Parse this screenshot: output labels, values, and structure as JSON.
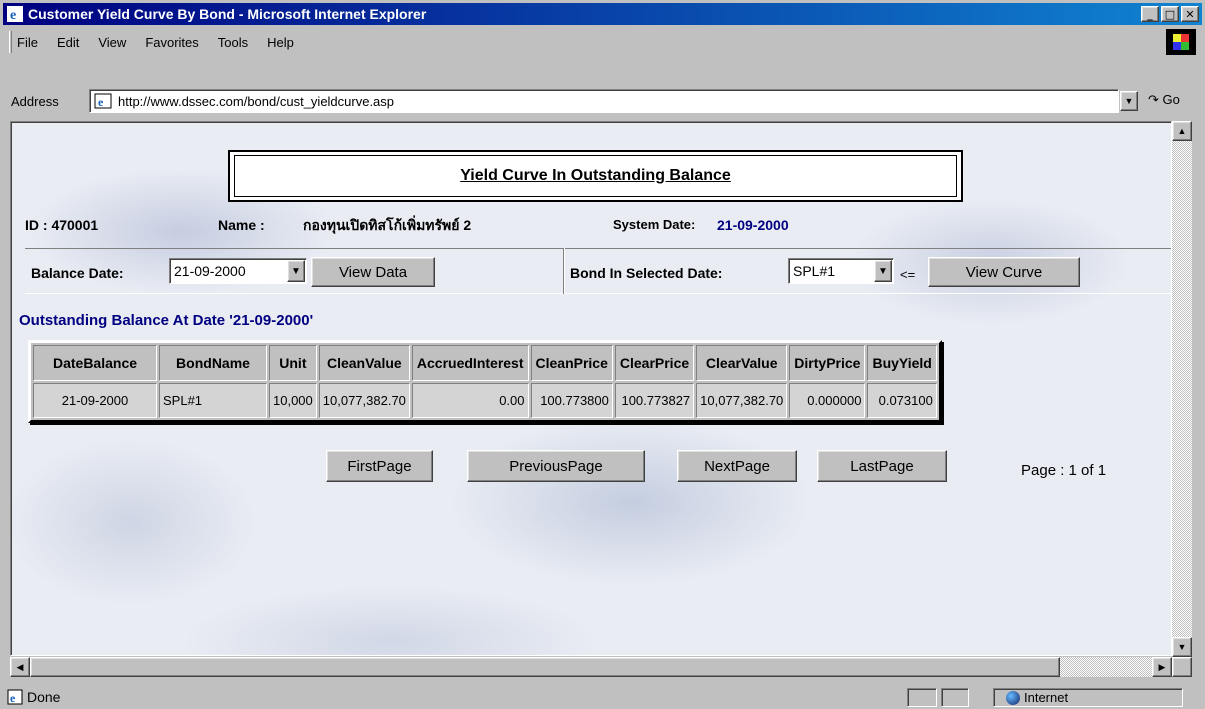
{
  "window": {
    "title": "Customer Yield Curve By Bond - Microsoft Internet Explorer"
  },
  "menu": [
    {
      "label": "File"
    },
    {
      "label": "Edit"
    },
    {
      "label": "View"
    },
    {
      "label": "Favorites"
    },
    {
      "label": "Tools"
    },
    {
      "label": "Help"
    }
  ],
  "address": {
    "label": "Address",
    "url": "http://www.dssec.com/bond/cust_yieldcurve.asp",
    "go_label": "Go"
  },
  "page": {
    "title": "Yield Curve In Outstanding Balance",
    "id_label": "ID : 470001",
    "name_label": "Name :",
    "name_value": "กองทุนเปิดทิสโก้เพิ่มทรัพย์ 2",
    "system_date_label": "System Date:",
    "system_date_value": "21-09-2000",
    "balance_date_label": "Balance Date:",
    "balance_date_value": "21-09-2000",
    "view_data_label": "View Data",
    "bond_selected_label": "Bond In Selected Date:",
    "bond_selected_value": "SPL#1",
    "lte_symbol": "<=",
    "view_curve_label": "View Curve",
    "outstanding_heading": "Outstanding Balance At Date '21-09-2000'"
  },
  "table": {
    "headers": [
      "DateBalance",
      "BondName",
      "Unit",
      "CleanValue",
      "AccruedInterest",
      "CleanPrice",
      "ClearPrice",
      "ClearValue",
      "DirtyPrice",
      "BuyYield"
    ],
    "rows": [
      [
        "21-09-2000",
        "SPL#1",
        "10,000",
        "10,077,382.70",
        "0.00",
        "100.773800",
        "100.773827",
        "10,077,382.70",
        "0.000000",
        "0.073100"
      ]
    ]
  },
  "pagination": {
    "first": "FirstPage",
    "previous": "PreviousPage",
    "next": "NextPage",
    "last": "LastPage",
    "page_info": "Page : 1 of 1"
  },
  "status": {
    "text": "Done",
    "zone": "Internet"
  },
  "colors": {
    "titlebar": "#000080",
    "heading_text": "#000080"
  }
}
